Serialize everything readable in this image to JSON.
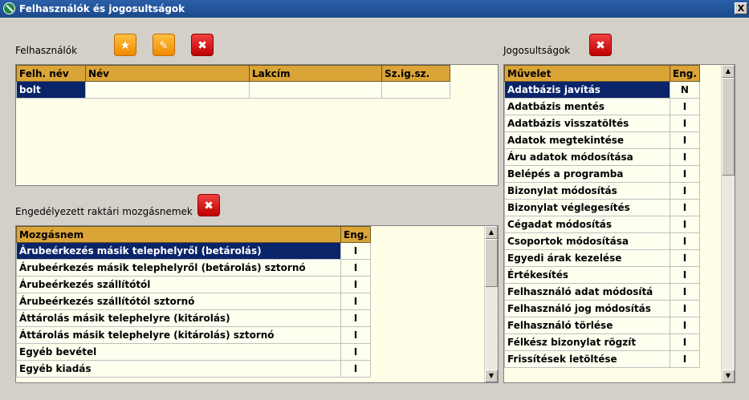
{
  "window": {
    "title": "Felhasználók és jogosultságok",
    "close_glyph": "X"
  },
  "users": {
    "label": "Felhasználók",
    "columns": [
      "Felh. név",
      "Név",
      "Lakcím",
      "Sz.ig.sz."
    ],
    "rows": [
      [
        "bolt",
        "",
        "",
        ""
      ]
    ],
    "selected_row": 0
  },
  "movements": {
    "label": "Engedélyezett raktári mozgásnemek",
    "columns": [
      "Mozgásnem",
      "Eng."
    ],
    "rows": [
      [
        "Árubeérkezés másik telephelyről (betárolás)",
        "I"
      ],
      [
        "Árubeérkezés másik telephelyről (betárolás) sztornó",
        "I"
      ],
      [
        "Árubeérkezés szállítótól",
        "I"
      ],
      [
        "Árubeérkezés szállítótól sztornó",
        "I"
      ],
      [
        "Áttárolás másik telephelyre (kitárolás)",
        "I"
      ],
      [
        "Áttárolás másik telephelyre (kitárolás) sztornó",
        "I"
      ],
      [
        "Egyéb bevétel",
        "I"
      ],
      [
        "Egyéb kiadás",
        "I"
      ]
    ],
    "selected_row": 0
  },
  "permissions": {
    "label": "Jogosultságok",
    "columns": [
      "Művelet",
      "Eng."
    ],
    "rows": [
      [
        "Adatbázis javítás",
        "N"
      ],
      [
        "Adatbázis mentés",
        "I"
      ],
      [
        "Adatbázis visszatöltés",
        "I"
      ],
      [
        "Adatok megtekintése",
        "I"
      ],
      [
        "Áru adatok módosítása",
        "I"
      ],
      [
        "Belépés a programba",
        "I"
      ],
      [
        "Bizonylat módosítás",
        "I"
      ],
      [
        "Bizonylat véglegesítés",
        "I"
      ],
      [
        "Cégadat módosítás",
        "I"
      ],
      [
        "Csoportok módosítása",
        "I"
      ],
      [
        "Egyedi árak kezelése",
        "I"
      ],
      [
        "Értékesítés",
        "I"
      ],
      [
        "Felhasználó adat módosítá",
        "I"
      ],
      [
        "Felhasználó jog módosítás",
        "I"
      ],
      [
        "Felhasználó törlése",
        "I"
      ],
      [
        "Félkész bizonylat rögzít",
        "I"
      ],
      [
        "Frissítések letöltése",
        "I"
      ]
    ],
    "selected_row": 0
  },
  "icons": {
    "new": "star-icon",
    "edit": "edit-icon",
    "delete": "delete-x-icon"
  },
  "colors": {
    "header": "#dba437",
    "selection": "#0a246a",
    "grid_bg": "#ffffe8",
    "delete": "#d01010",
    "action": "#f5a020"
  }
}
